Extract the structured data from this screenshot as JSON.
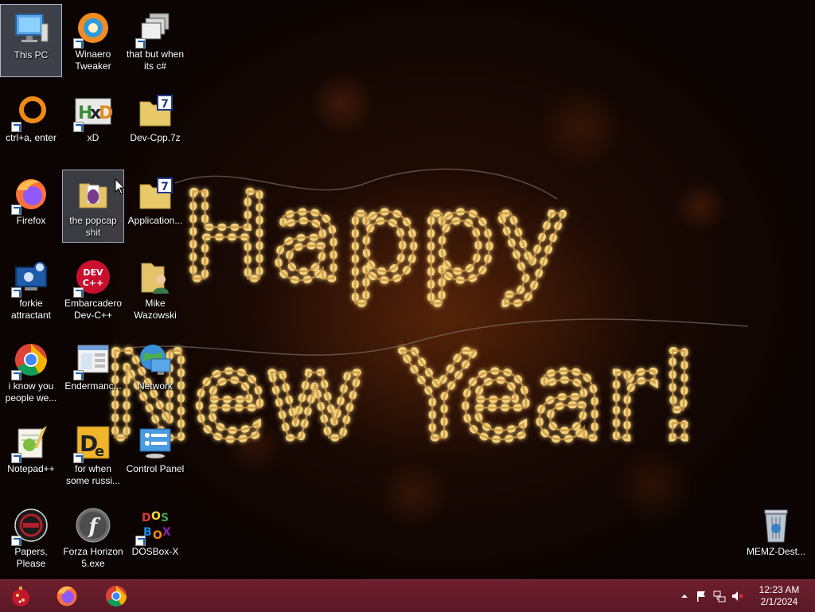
{
  "desktop": {
    "icons": [
      {
        "label": "This PC",
        "icon": "computer-icon"
      },
      {
        "label": "Winaero Tweaker",
        "icon": "winaero-icon"
      },
      {
        "label": "that but when its c#",
        "icon": "stacked-windows-icon"
      },
      {
        "label": "ctrl+a, enter",
        "icon": "orange-ring-icon"
      },
      {
        "label": "xD",
        "icon": "hxd-icon"
      },
      {
        "label": "Dev-Cpp.7z",
        "icon": "archive-folder-icon"
      },
      {
        "label": "Firefox",
        "icon": "firefox-icon"
      },
      {
        "label": "the popcap shit",
        "icon": "folder-icon"
      },
      {
        "label": "Application...",
        "icon": "archive-folder-icon"
      },
      {
        "label": "forkie attractant",
        "icon": "settings-monitor-icon"
      },
      {
        "label": "Embarcadero Dev-C++",
        "icon": "devcpp-icon"
      },
      {
        "label": "Mike Wazowski",
        "icon": "user-folder-icon"
      },
      {
        "label": "i know you people we...",
        "icon": "chrome-icon"
      },
      {
        "label": "Endermanc...",
        "icon": "window-app-icon"
      },
      {
        "label": "Network",
        "icon": "network-icon"
      },
      {
        "label": "Notepad++",
        "icon": "notepadpp-icon"
      },
      {
        "label": "for when some russi...",
        "icon": "de-icon"
      },
      {
        "label": "Control Panel",
        "icon": "control-panel-icon"
      },
      {
        "label": "Papers, Please",
        "icon": "papers-please-icon"
      },
      {
        "label": "Forza Horizon 5.exe",
        "icon": "flash-icon"
      },
      {
        "label": "DOSBox-X",
        "icon": "dosbox-icon"
      },
      {
        "label": "MEMZ-Dest...",
        "icon": "recycle-bin-icon"
      }
    ],
    "wallpaper_text_line1": "Happy",
    "wallpaper_text_line2": "New Year!"
  },
  "taskbar": {
    "pinned": [
      "ornament-start-icon",
      "firefox-icon",
      "chrome-icon"
    ],
    "tray_icons": [
      "chevron-up-icon",
      "flag-icon",
      "network-icon",
      "volume-muted-icon"
    ],
    "time": "12:23 AM",
    "date": "2/1/2024"
  },
  "colors": {
    "taskbar": "#6e1f2e",
    "wallpaper": "#2a0f06",
    "light_gold": "#f5d27a"
  }
}
